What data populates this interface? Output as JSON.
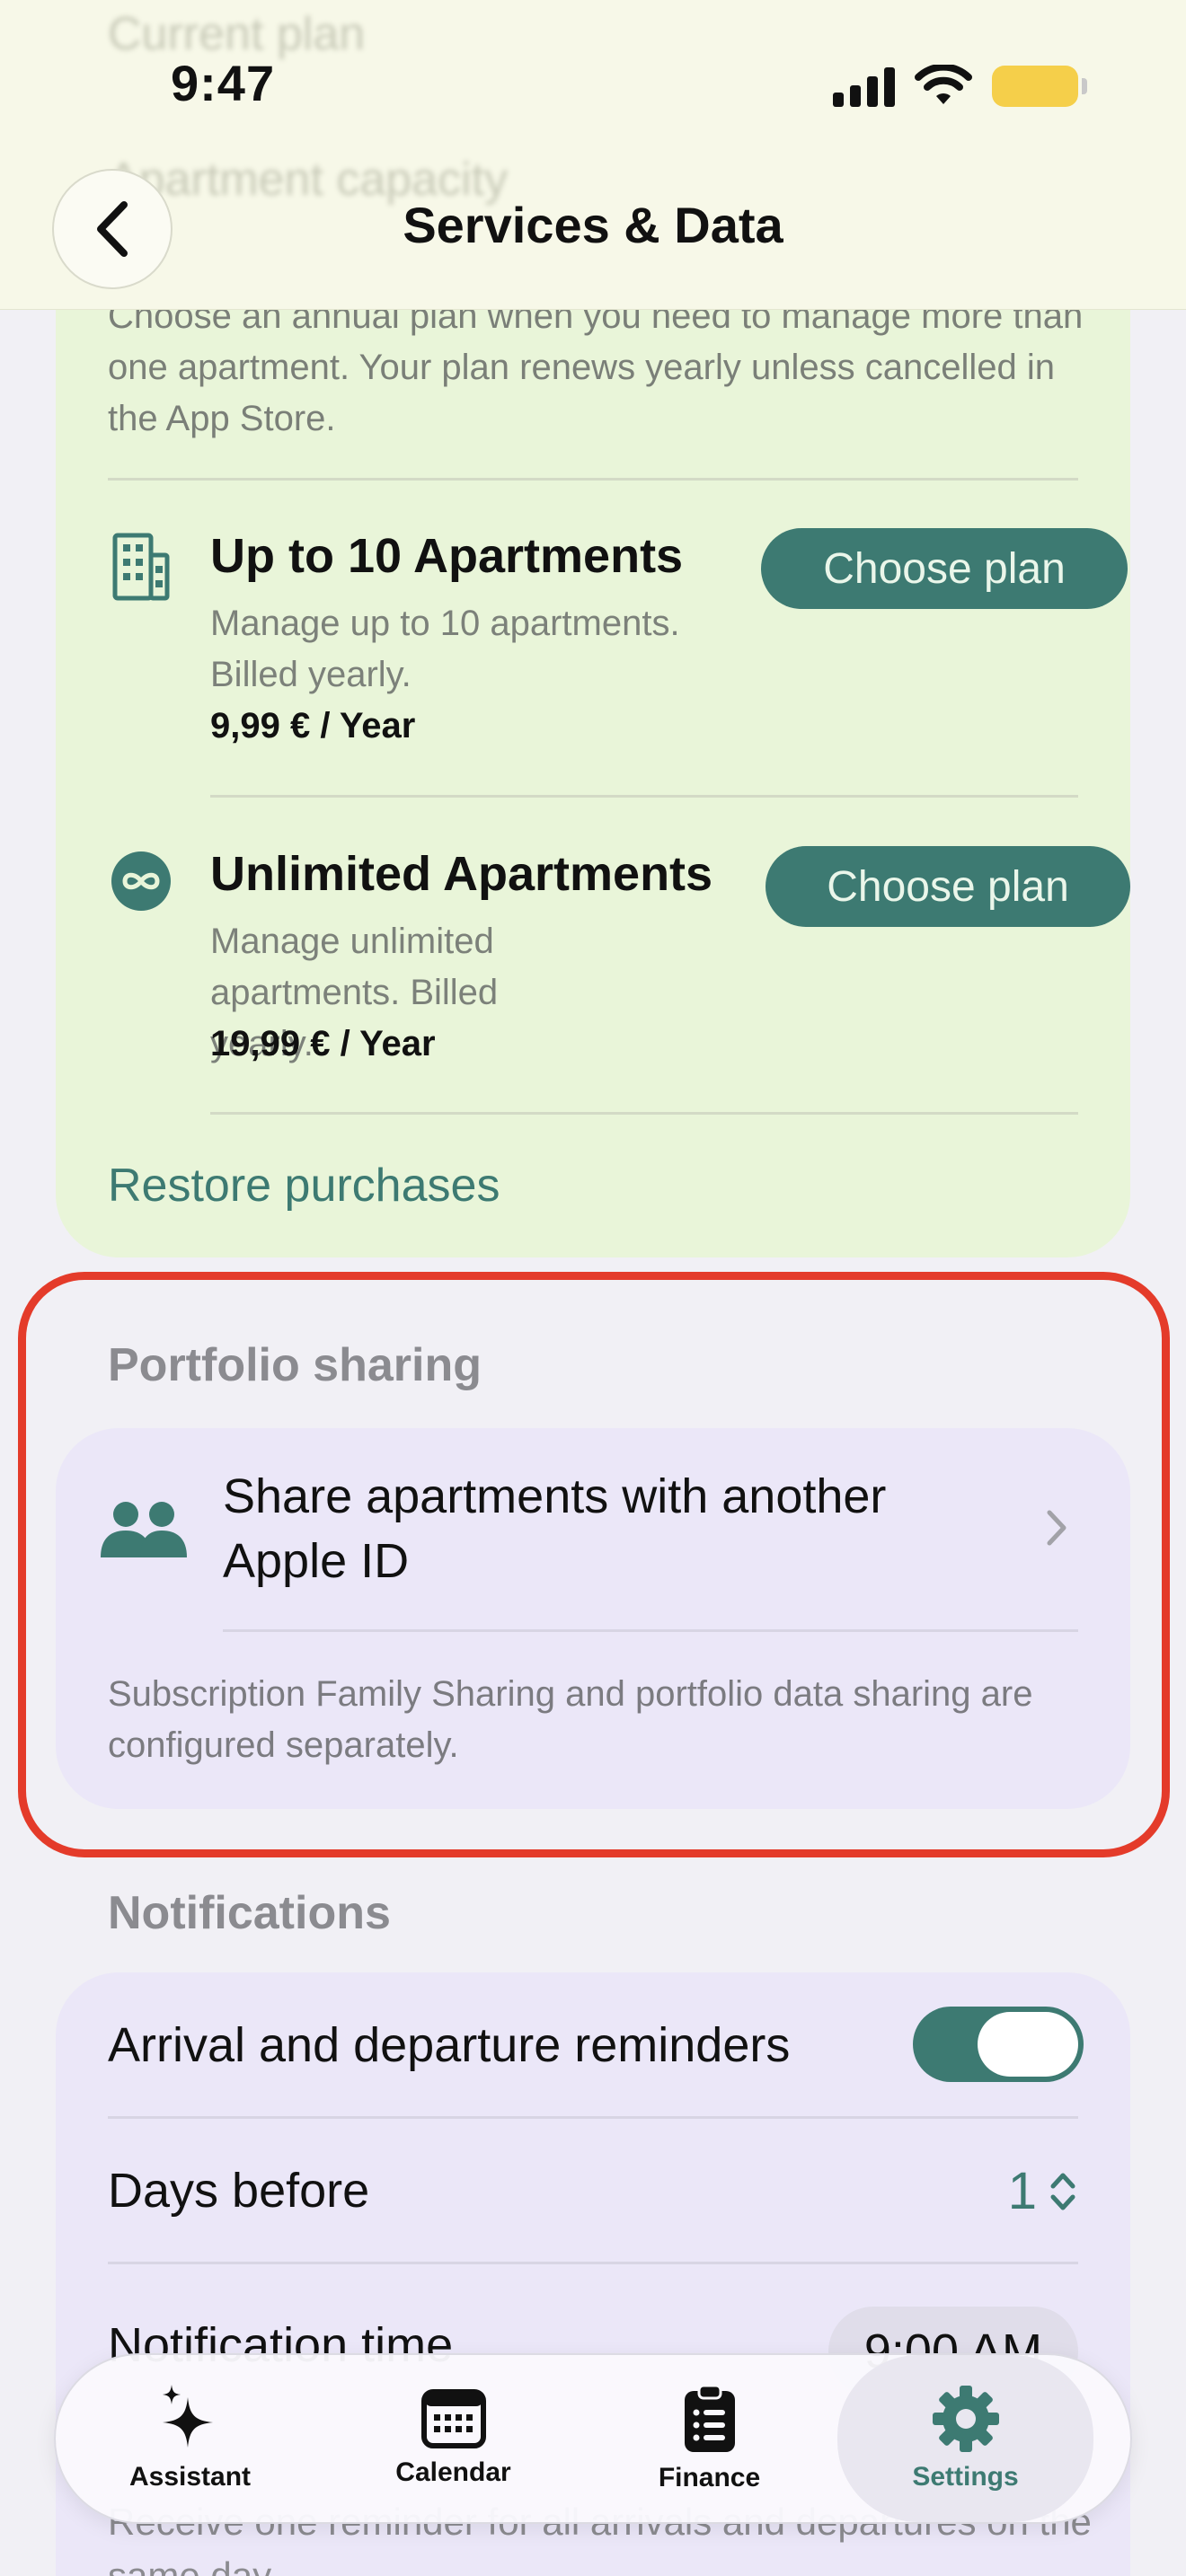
{
  "status_bar": {
    "time": "9:47"
  },
  "header": {
    "title": "Services & Data",
    "ghost_rows": [
      "Current plan",
      "Apartment capacity"
    ]
  },
  "plans": {
    "description": "Choose an annual plan when you need to manage more than one apartment. Your plan renews yearly unless cancelled in the App Store.",
    "items": [
      {
        "name": "Up to 10 Apartments",
        "subtitle": "Manage up to 10 apartments. Billed yearly.",
        "price": "9,99 € / Year",
        "button": "Choose plan",
        "icon": "building-icon"
      },
      {
        "name": "Unlimited Apartments",
        "subtitle": "Manage unlimited apartments. Billed yearly.",
        "price": "19,99 € / Year",
        "button": "Choose plan",
        "icon": "infinity-icon"
      }
    ],
    "restore_label": "Restore purchases"
  },
  "portfolio": {
    "section_label": "Portfolio sharing",
    "share_label": "Share apartments with another Apple ID",
    "note": "Subscription Family Sharing and portfolio data sharing are configured separately."
  },
  "notifications": {
    "section_label": "Notifications",
    "reminders_label": "Arrival and departure reminders",
    "reminders_on": true,
    "days_before_label": "Days before",
    "days_before_value": "1",
    "time_label": "Notification time",
    "time_value": "9:00 AM",
    "footer_note": "Receive one reminder for all arrivals and departures on the same day."
  },
  "tabbar": {
    "tabs": [
      {
        "label": "Assistant",
        "icon": "sparkles-icon"
      },
      {
        "label": "Calendar",
        "icon": "calendar-icon"
      },
      {
        "label": "Finance",
        "icon": "clipboard-icon"
      },
      {
        "label": "Settings",
        "icon": "gear-icon",
        "active": true
      }
    ]
  },
  "colors": {
    "accent": "#3d7a72",
    "plan_card_bg": "#e9f5d9",
    "section_card_bg": "#ebe7f8",
    "highlight": "#e43b2a",
    "header_bg": "#f7f8e8"
  }
}
